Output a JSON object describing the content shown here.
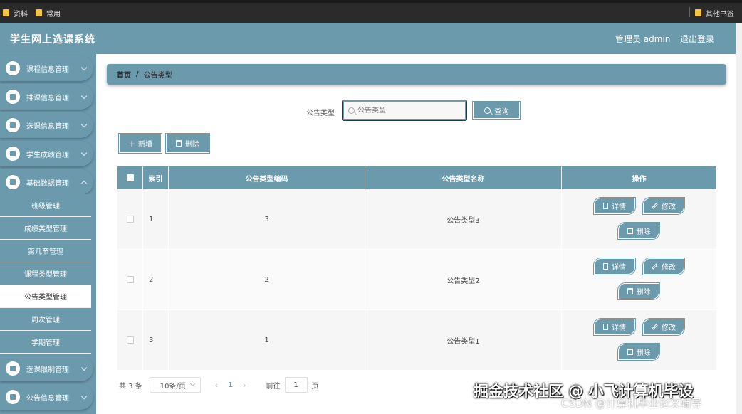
{
  "browser": {
    "bookmarks": [
      "资料",
      "常用"
    ],
    "other_bookmarks": "其他书签"
  },
  "header": {
    "title": "学生网上选课系统",
    "user": "管理员 admin",
    "logout": "退出登录"
  },
  "sidebar": {
    "menus": [
      "课程信息管理",
      "排课信息管理",
      "选课信息管理",
      "学生成绩管理",
      "基础数据管理",
      "选课限制管理",
      "公告信息管理"
    ],
    "submenu": [
      "班级管理",
      "成绩类型管理",
      "第几节管理",
      "课程类型管理",
      "公告类型管理",
      "周次管理",
      "学期管理"
    ],
    "active_submenu": "公告类型管理"
  },
  "breadcrumb": {
    "home": "首页",
    "separator": "/",
    "current": "公告类型"
  },
  "search": {
    "label": "公告类型",
    "placeholder": "公告类型",
    "button": "查询"
  },
  "toolbar": {
    "add": "新增",
    "delete": "删除"
  },
  "table": {
    "headers": [
      "索引",
      "公告类型编码",
      "公告类型名称",
      "操作"
    ],
    "rows": [
      {
        "index": "1",
        "code": "3",
        "name": "公告类型3"
      },
      {
        "index": "2",
        "code": "2",
        "name": "公告类型2"
      },
      {
        "index": "3",
        "code": "1",
        "name": "公告类型1"
      }
    ],
    "actions": {
      "detail": "详情",
      "edit": "修改",
      "delete": "删除"
    }
  },
  "pagination": {
    "total": "共 3 条",
    "page_size": "10条/页",
    "current_page": "1",
    "goto_label": "前往",
    "goto_value": "1",
    "page_unit": "页"
  },
  "watermark": {
    "line1": "掘金技术社区 @ 小飞计算机毕设",
    "line2": "CSDN @计算机毕业论文辅导"
  },
  "colors": {
    "primary": "#6b9aac",
    "active_bg": "#ffffff"
  }
}
